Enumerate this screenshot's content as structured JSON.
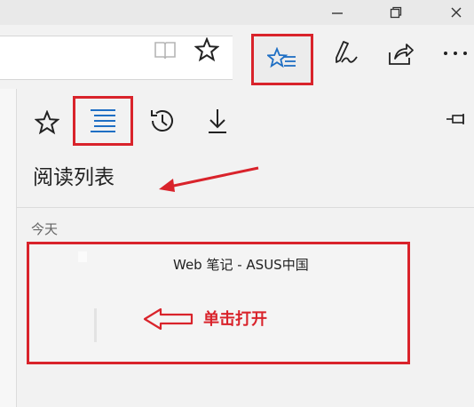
{
  "panel": {
    "title": "阅读列表",
    "section_label": "今天"
  },
  "reading_list": {
    "items": [
      {
        "title": "Web 笔记 - ASUS中国"
      }
    ]
  },
  "annotation": {
    "click_label": "单击打开"
  },
  "icons": {
    "window": [
      "minimize-icon",
      "maximize-icon",
      "close-icon"
    ],
    "toolbar": [
      "reading-view-icon",
      "favorite-star-icon",
      "hub-icon",
      "pen-icon",
      "share-icon",
      "more-icon"
    ],
    "hub_tabs": [
      "favorites-icon",
      "reading-list-icon",
      "history-icon",
      "downloads-icon",
      "pin-icon"
    ]
  },
  "colors": {
    "accent_blue": "#1f6fc4",
    "highlight_red": "#d9232b"
  }
}
